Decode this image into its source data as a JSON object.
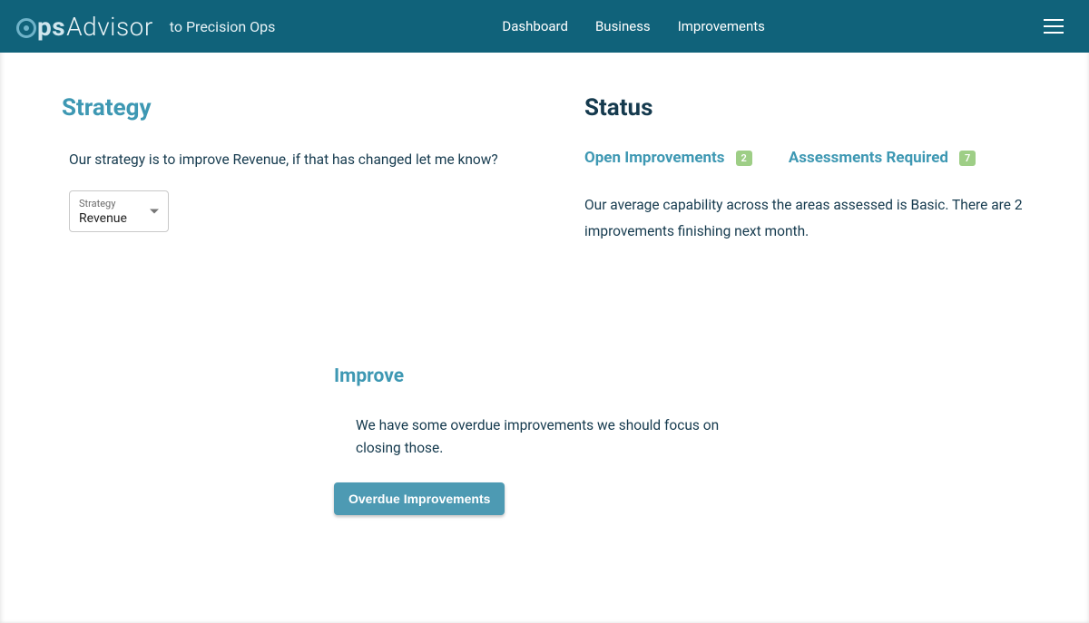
{
  "header": {
    "logo_ops": "ps",
    "logo_advisor": "Advisor",
    "tagline": "to Precision Ops",
    "nav": [
      "Dashboard",
      "Business",
      "Improvements"
    ]
  },
  "strategy": {
    "title": "Strategy",
    "text": "Our strategy is to improve Revenue, if that has changed let me know?",
    "select_label": "Strategy",
    "select_value": "Revenue"
  },
  "status": {
    "title": "Status",
    "open_label": "Open Improvements",
    "open_count": "2",
    "assess_label": "Assessments Required",
    "assess_count": "7",
    "text": "Our average capability across the areas assessed is Basic. There are 2 improvements finishing next month."
  },
  "improve": {
    "title": "Improve",
    "text": "We have some overdue improvements we should focus on closing those.",
    "button": "Overdue Improvements"
  }
}
